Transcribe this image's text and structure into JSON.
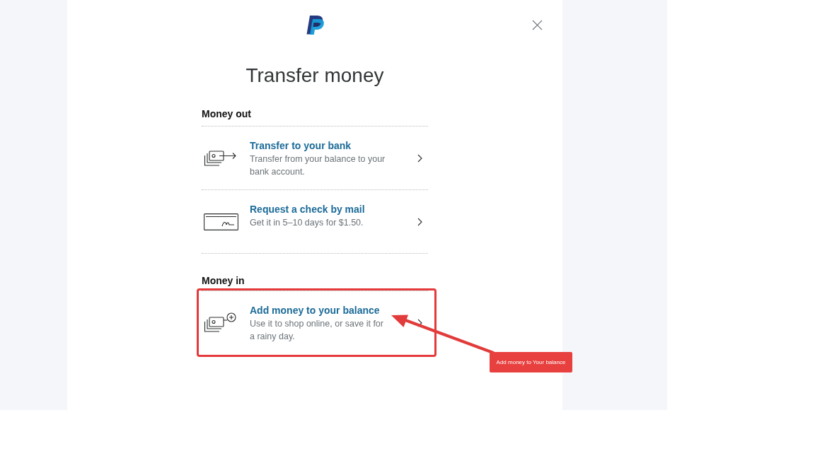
{
  "dialog": {
    "title": "Transfer money"
  },
  "sections": [
    {
      "heading": "Money out",
      "items": [
        {
          "kind": "bank",
          "title": "Transfer to your bank",
          "description": "Transfer from your balance to your bank account.",
          "highlighted": false
        },
        {
          "kind": "check",
          "title": "Request a check by mail",
          "description": "Get it in 5–10 days for $1.50.",
          "highlighted": false
        }
      ]
    },
    {
      "heading": "Money in",
      "items": [
        {
          "kind": "add",
          "title": "Add money to your balance",
          "description": "Use it to shop online, or save it for a rainy day.",
          "highlighted": true
        }
      ]
    }
  ],
  "annotation": {
    "label": "Add money to Your balance"
  }
}
